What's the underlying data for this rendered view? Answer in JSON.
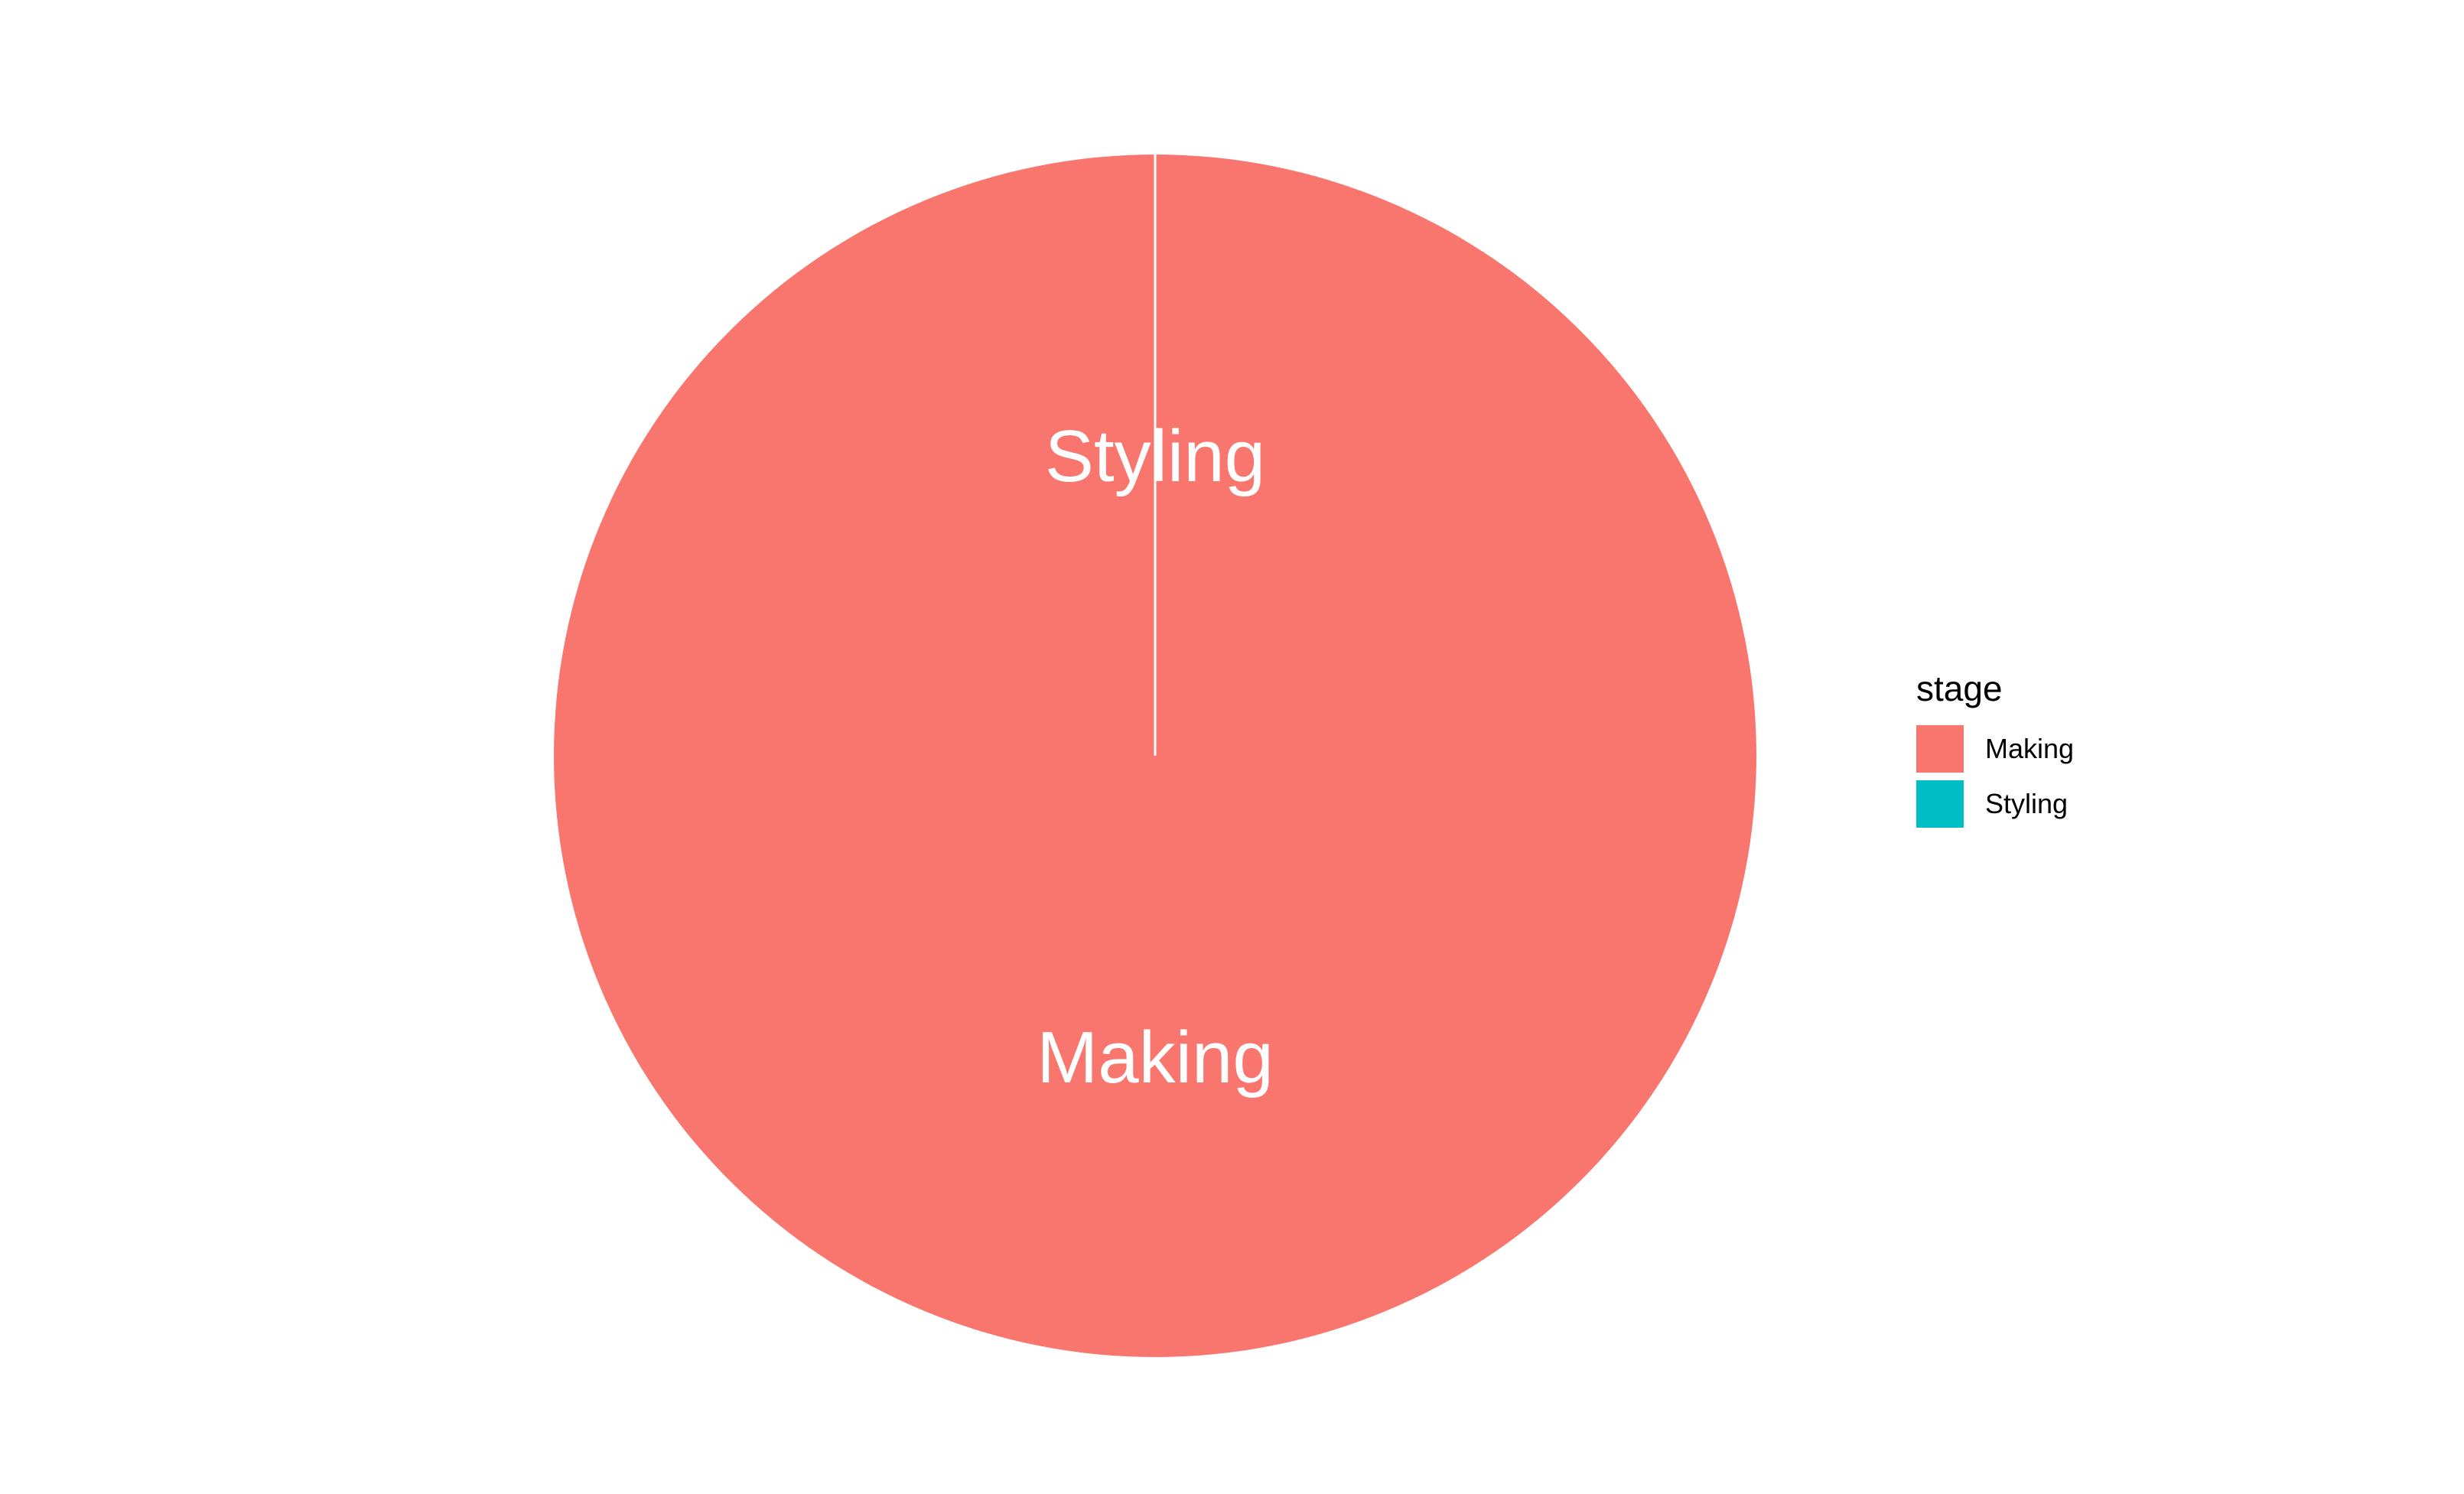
{
  "chart_data": {
    "type": "pie",
    "categories": [
      "Making",
      "Styling"
    ],
    "values": [
      100,
      0
    ],
    "labels": [
      "Making",
      "Styling"
    ],
    "colors": {
      "Making": "#F8766D",
      "Styling": "#00BFC4",
      "separator": "#FFFFFF"
    },
    "legend": {
      "title": "stage",
      "placement": "right",
      "items": [
        {
          "label": "Making",
          "color": "#F8766D"
        },
        {
          "label": "Styling",
          "color": "#00BFC4"
        }
      ]
    }
  }
}
